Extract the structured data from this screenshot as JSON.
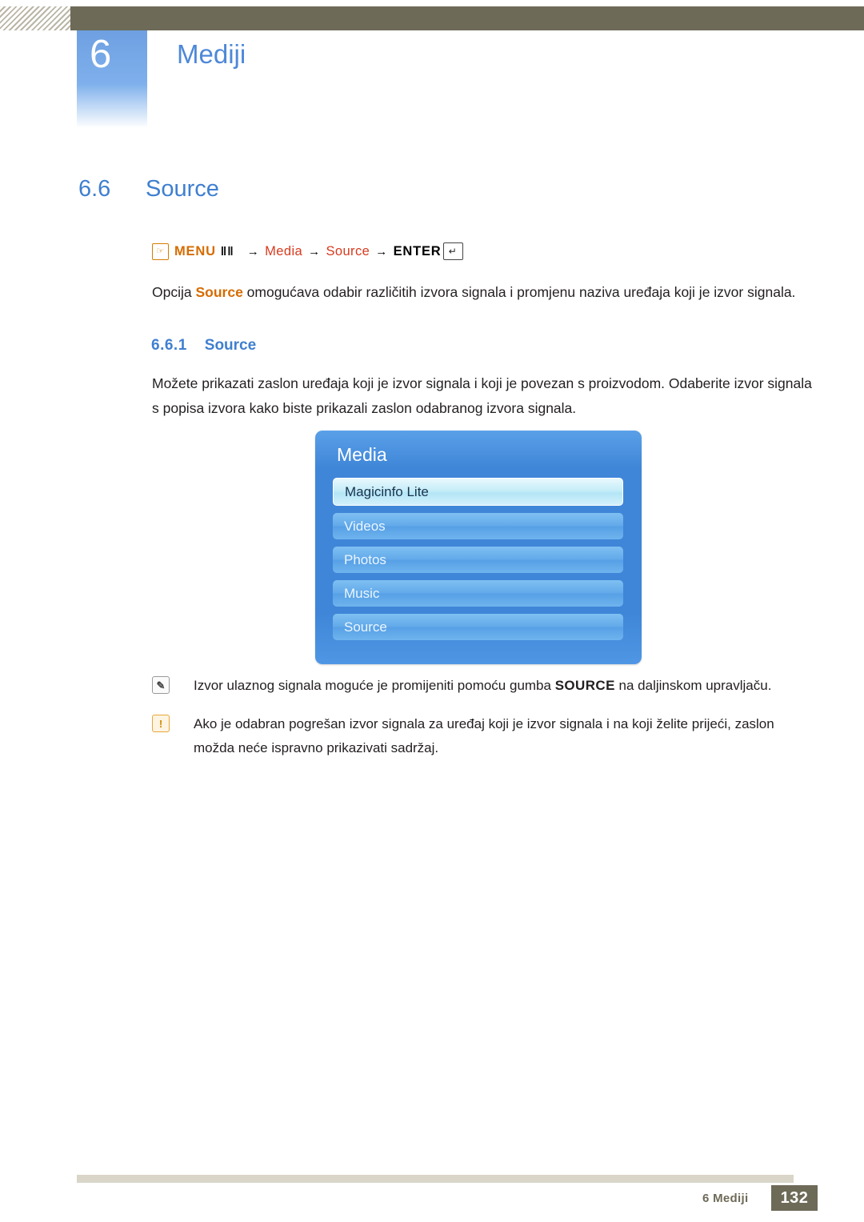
{
  "header": {
    "chapter_number": "6",
    "chapter_title": "Mediji"
  },
  "section": {
    "number": "6.6",
    "title": "Source"
  },
  "menu_path": {
    "hand_icon": "hand-icon",
    "menu_label": "MENU",
    "menu_glyph": "‖‖",
    "arrow": "→",
    "item1": "Media",
    "item2": "Source",
    "enter_label": "ENTER",
    "enter_bracket_left": "[",
    "enter_bracket_right": "]",
    "enter_key_glyph": "↵"
  },
  "intro_paragraph": {
    "before": "Opcija ",
    "keyword": "Source",
    "after": " omogućava odabir različitih izvora signala i promjenu naziva uređaja koji je izvor signala."
  },
  "subsection": {
    "number": "6.6.1",
    "title": "Source"
  },
  "body_paragraph": "Možete prikazati zaslon uređaja koji je izvor signala i koji je povezan s proizvodom. Odaberite izvor signala s popisa izvora kako biste prikazali zaslon odabranog izvora signala.",
  "osd": {
    "title": "Media",
    "items": [
      {
        "label": "Magicinfo Lite",
        "selected": true
      },
      {
        "label": "Videos",
        "selected": false
      },
      {
        "label": "Photos",
        "selected": false
      },
      {
        "label": "Music",
        "selected": false
      },
      {
        "label": "Source",
        "selected": false
      }
    ]
  },
  "notes": [
    {
      "icon": "pencil-note-icon",
      "icon_glyph": "✎",
      "before": "Izvor ulaznog signala moguće je promijeniti pomoću gumba ",
      "keyword": "SOURCE",
      "after": " na daljinskom upravljaču."
    },
    {
      "icon": "warning-icon",
      "icon_glyph": "!",
      "text": "Ako je odabran pogrešan izvor signala za uređaj koji je izvor signala i na koji želite prijeći, zaslon možda neće ispravno prikazivati sadržaj."
    }
  ],
  "footer": {
    "label": "6 Mediji",
    "page": "132"
  },
  "colors": {
    "heading_blue": "#3f7fd0",
    "chapter_blue": "#4e88d8",
    "orange": "#d56c00",
    "red": "#d83a1e",
    "khaki": "#6e6a58",
    "osd_blue": "#3f86d8"
  }
}
